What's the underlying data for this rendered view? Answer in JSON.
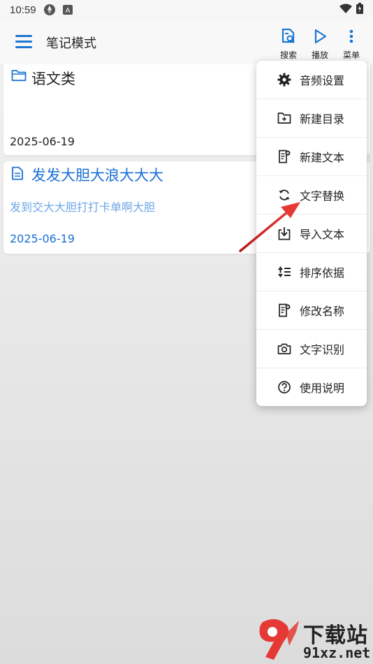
{
  "status_bar": {
    "time": "10:59"
  },
  "app_bar": {
    "title": "笔记模式",
    "actions": {
      "search": "搜索",
      "play": "播放",
      "menu": "菜单"
    }
  },
  "notes": [
    {
      "title": "语文类",
      "icon": "folder-icon",
      "date": "2025-06-19"
    },
    {
      "title": "发发大胆大浪大大大",
      "icon": "document-icon",
      "preview": "发到交大大胆打打卡单啊大胆",
      "date": "2025-06-19"
    }
  ],
  "popup_menu": [
    {
      "label": "音频设置",
      "icon": "gear-icon"
    },
    {
      "label": "新建目录",
      "icon": "new-folder-icon"
    },
    {
      "label": "新建文本",
      "icon": "new-document-icon"
    },
    {
      "label": "文字替换",
      "icon": "refresh-icon"
    },
    {
      "label": "导入文本",
      "icon": "import-icon"
    },
    {
      "label": "排序依据",
      "icon": "sort-icon"
    },
    {
      "label": "修改名称",
      "icon": "rename-icon"
    },
    {
      "label": "文字识别",
      "icon": "camera-icon"
    },
    {
      "label": "使用说明",
      "icon": "help-icon"
    }
  ],
  "colors": {
    "accent": "#1976d2",
    "link": "#1a6fd6",
    "preview": "#6fa6e6",
    "annotation_arrow": "#d32f2f"
  },
  "watermark": {
    "top": "下载站",
    "bottom": "91xz.net",
    "logo": "9f"
  }
}
